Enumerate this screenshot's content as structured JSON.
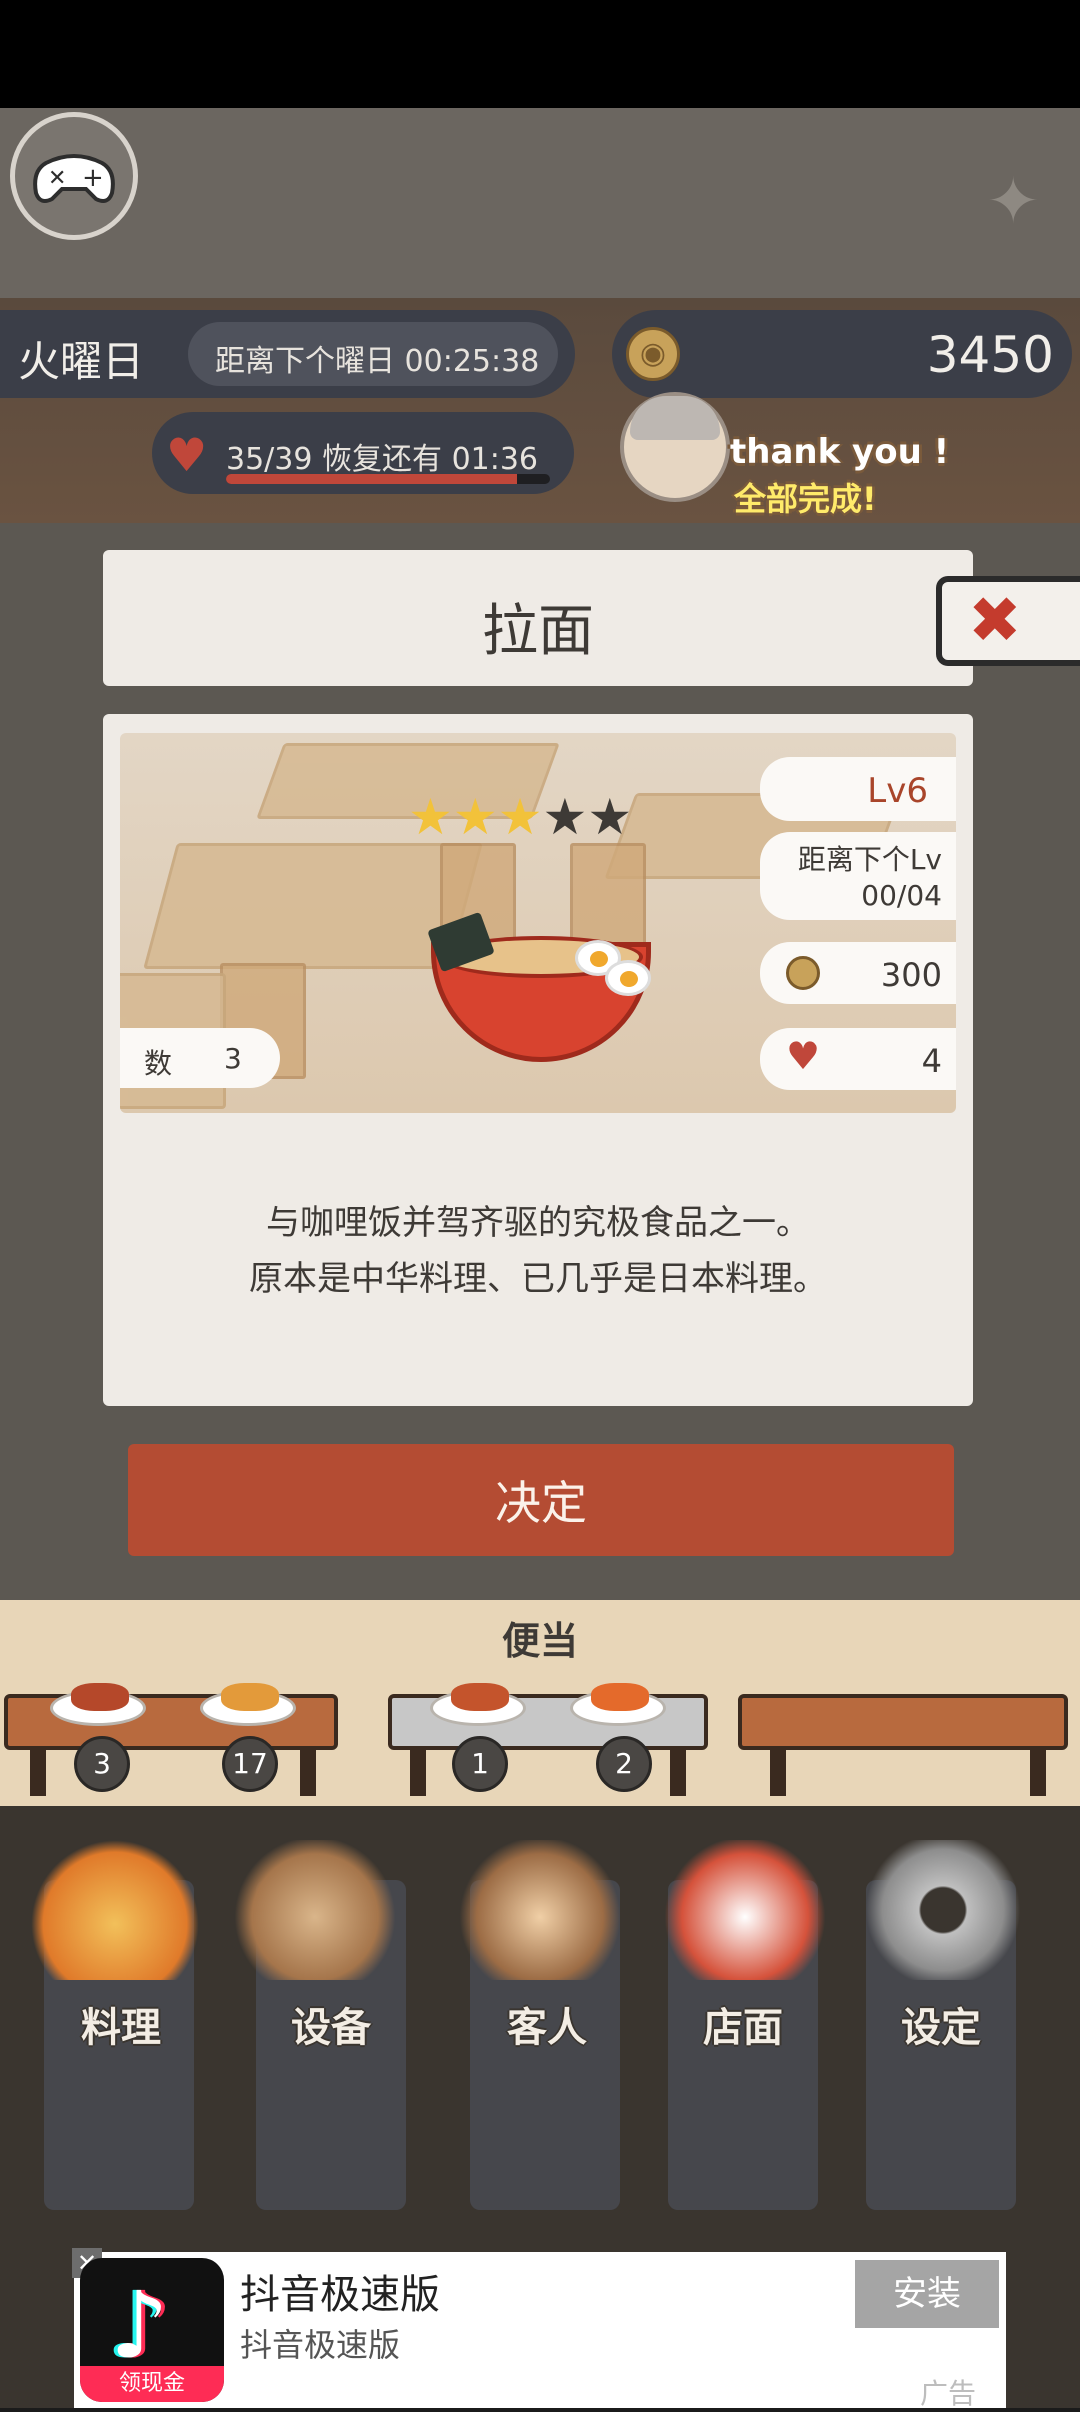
{
  "header": {
    "day_name": "火曜日",
    "next_day_label": "距离下个曜日",
    "next_day_time": "00:25:38",
    "coins": "3450",
    "stamina": "35/39",
    "recover_label": "恢复还有",
    "recover_time": "01:36",
    "stamina_fraction": 0.897,
    "thanks_line1": "thank you !",
    "thanks_line2": "全部完成!"
  },
  "dialog": {
    "title": "拉面",
    "stars_filled": 3,
    "stars_total": 5,
    "level": "Lv6",
    "next_level_label": "距离下个Lv",
    "next_level_progress": "00/04",
    "price": "300",
    "hearts": "4",
    "quantity_label": "数",
    "quantity": "3",
    "description_line1": "与咖哩饭并驾齐驱的究极食品之一。",
    "description_line2": "原本是中华料理、已几乎是日本料理。",
    "confirm_label": "决定"
  },
  "bento": {
    "title": "便当",
    "slots": [
      {
        "count": "3",
        "food_color": "#b5482a"
      },
      {
        "count": "17",
        "food_color": "#e39a3a"
      },
      {
        "count": "1",
        "food_color": "#c4542c"
      },
      {
        "count": "2",
        "food_color": "#e46a2b"
      }
    ]
  },
  "nav": {
    "items": [
      {
        "label": "料理",
        "icon": "cooking-pot-icon"
      },
      {
        "label": "设备",
        "icon": "house-icon"
      },
      {
        "label": "客人",
        "icon": "customers-icon"
      },
      {
        "label": "店面",
        "icon": "lucky-cat-icon"
      },
      {
        "label": "设定",
        "icon": "gear-icon"
      }
    ]
  },
  "ad": {
    "title": "抖音极速版",
    "subtitle": "抖音极速版",
    "badge": "领现金",
    "install_label": "安装",
    "tag": "广告"
  },
  "colors": {
    "accent": "#b44c33",
    "star_on": "#f2c23a",
    "heart": "#c0473a",
    "panel": "#efebe6"
  }
}
